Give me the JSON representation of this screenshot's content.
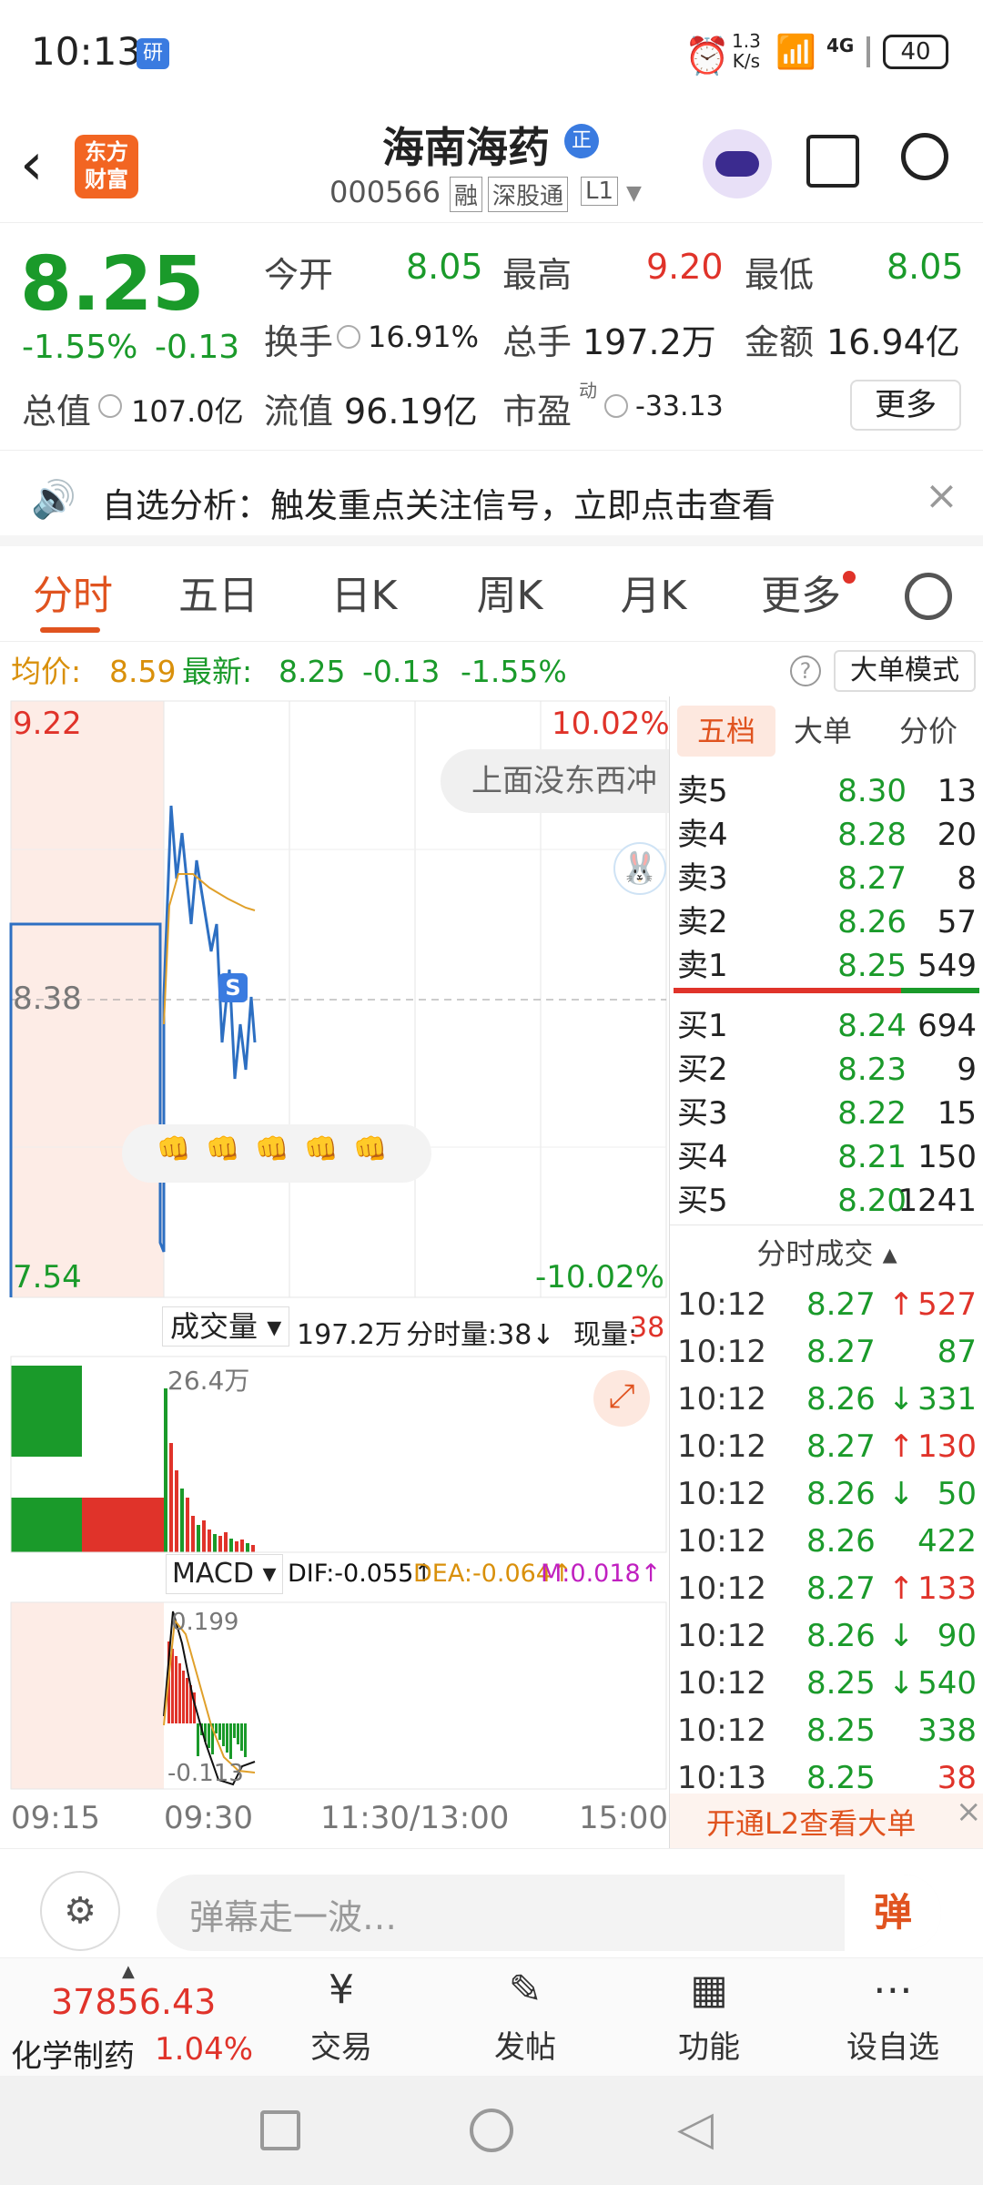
{
  "status": {
    "time": "10:13",
    "app_badge": "研",
    "net_speed_top": "1.3",
    "net_speed_unit": "K/s",
    "network": "4G",
    "battery": "40"
  },
  "header": {
    "title": "海南海药",
    "title_badge": "正",
    "code": "000566",
    "tags": [
      "融",
      "深股通",
      "L1"
    ],
    "brand_line1": "东方",
    "brand_line2": "财富"
  },
  "quote": {
    "price": "8.25",
    "change_pct": "-1.55%",
    "change": "-0.13",
    "open_label": "今开",
    "open": "8.05",
    "high_label": "最高",
    "high": "9.20",
    "low_label": "最低",
    "low": "8.05",
    "turnover_label": "换手",
    "turnover": "16.91%",
    "vol_label": "总手",
    "vol": "197.2万",
    "amount_label": "金额",
    "amount": "16.94亿",
    "mktcap_label": "总值",
    "mktcap": "107.0亿",
    "float_label": "流值",
    "float": "96.19亿",
    "pe_label": "市盈",
    "pe_sup": "动",
    "pe": "-33.13",
    "more_label": "更多"
  },
  "banner": {
    "text": "自选分析：触发重点关注信号，立即点击查看"
  },
  "tabs": [
    "分时",
    "五日",
    "日K",
    "周K",
    "月K",
    "更多"
  ],
  "infoline": {
    "avg_label": "均价:",
    "avg": "8.59",
    "latest_label": "最新:",
    "latest": "8.25",
    "chg": "-0.13",
    "pct": "-1.55%",
    "mode": "大单模式"
  },
  "chart": {
    "y_max": "9.22",
    "y_mid": "8.38",
    "y_min": "7.54",
    "pct_max": "10.02%",
    "pct_min": "-10.02%",
    "danmaku": "上面没东西冲",
    "vol_label": "成交量",
    "vol_total": "197.2万",
    "vol_min_label": "分时量:38↓",
    "vol_now_label": "现量:",
    "vol_now": "38",
    "vol_axis": "26.4万",
    "macd_label": "MACD",
    "dif": "DIF:-0.055↑",
    "dea": "DEA:-0.064↑",
    "m": "M:0.018↑",
    "macd_top": "0.199",
    "macd_bot": "-0.113",
    "time_labels": [
      "09:15",
      "09:30",
      "11:30/13:00",
      "15:00"
    ],
    "colors": {
      "price_line": "#2d6fc2",
      "avg_line": "#e0a02a",
      "up": "#e0332a",
      "down": "#1a9a2a"
    }
  },
  "panel": {
    "tabs": [
      "五档",
      "大单",
      "分价"
    ],
    "asks": [
      {
        "l": "卖5",
        "p": "8.30",
        "v": "13"
      },
      {
        "l": "卖4",
        "p": "8.28",
        "v": "20"
      },
      {
        "l": "卖3",
        "p": "8.27",
        "v": "8"
      },
      {
        "l": "卖2",
        "p": "8.26",
        "v": "57"
      },
      {
        "l": "卖1",
        "p": "8.25",
        "v": "549"
      }
    ],
    "bids": [
      {
        "l": "买1",
        "p": "8.24",
        "v": "694"
      },
      {
        "l": "买2",
        "p": "8.23",
        "v": "9"
      },
      {
        "l": "买3",
        "p": "8.22",
        "v": "15"
      },
      {
        "l": "买4",
        "p": "8.21",
        "v": "150"
      },
      {
        "l": "买5",
        "p": "8.20",
        "v": "1241"
      }
    ],
    "trades_title": "分时成交",
    "trades": [
      {
        "t": "10:12",
        "p": "8.27",
        "a": "↑",
        "v": "527",
        "c": "red"
      },
      {
        "t": "10:12",
        "p": "8.27",
        "a": "",
        "v": "87",
        "c": "green"
      },
      {
        "t": "10:12",
        "p": "8.26",
        "a": "↓",
        "v": "331",
        "c": "green"
      },
      {
        "t": "10:12",
        "p": "8.27",
        "a": "↑",
        "v": "130",
        "c": "red"
      },
      {
        "t": "10:12",
        "p": "8.26",
        "a": "↓",
        "v": "50",
        "c": "green"
      },
      {
        "t": "10:12",
        "p": "8.26",
        "a": "",
        "v": "422",
        "c": "green"
      },
      {
        "t": "10:12",
        "p": "8.27",
        "a": "↑",
        "v": "133",
        "c": "red"
      },
      {
        "t": "10:12",
        "p": "8.26",
        "a": "↓",
        "v": "90",
        "c": "green"
      },
      {
        "t": "10:12",
        "p": "8.25",
        "a": "↓",
        "v": "540",
        "c": "green"
      },
      {
        "t": "10:12",
        "p": "8.25",
        "a": "",
        "v": "338",
        "c": "green"
      },
      {
        "t": "10:13",
        "p": "8.25",
        "a": "",
        "v": "38",
        "c": "red"
      }
    ],
    "l2_label": "开通L2查看大单"
  },
  "comment": {
    "placeholder": "弹幕走一波…",
    "danmu_btn": "弹"
  },
  "bottom": {
    "index_value": "37856.43",
    "index_name": "化学制药",
    "index_pct": "1.04%",
    "items": [
      "交易",
      "发帖",
      "功能",
      "设自选"
    ]
  }
}
